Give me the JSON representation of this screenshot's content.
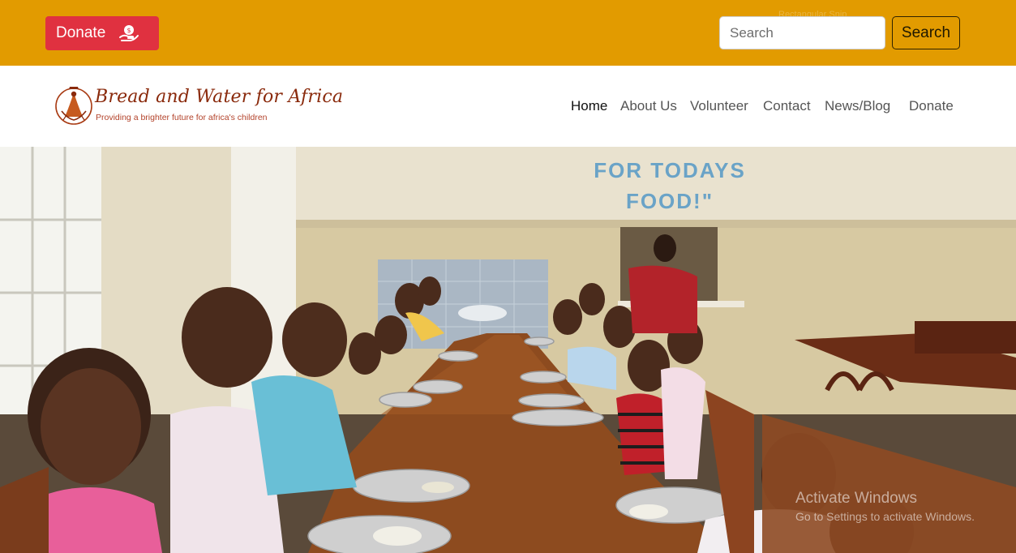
{
  "topbar": {
    "donate_label": "Donate",
    "donate_icon": "hand-coin-icon",
    "search_placeholder": "Search",
    "search_value": "",
    "search_button": "Search",
    "snip_hint": "Rectangular Snip",
    "background_color": "#e29b00",
    "donate_color": "#e03140"
  },
  "logo": {
    "title": "Bread and Water for Africa",
    "tagline": "Providing a brighter future for africa's children",
    "color": "#8a2a0c"
  },
  "nav": {
    "items": [
      {
        "label": "Home",
        "active": true
      },
      {
        "label": "About Us"
      },
      {
        "label": "Volunteer"
      },
      {
        "label": "Contact"
      },
      {
        "label": "News/Blog"
      },
      {
        "label": "Donate"
      }
    ]
  },
  "hero": {
    "wall_text_line1": "FOR TODAYS",
    "wall_text_line2": "FOOD!\""
  },
  "watermark": {
    "title": "Activate Windows",
    "subtitle": "Go to Settings to activate Windows."
  }
}
